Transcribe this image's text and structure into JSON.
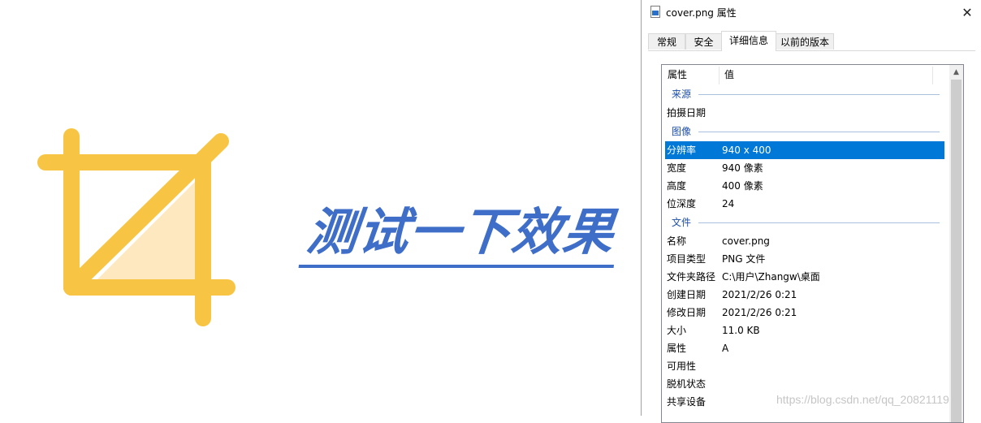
{
  "headline": "测试一下效果",
  "colors": {
    "icon_yellow": "#f7c543",
    "icon_fill": "#fde8bf",
    "headline_blue": "#3e6ec8",
    "selection": "#0078d7"
  },
  "window": {
    "title": "cover.png 属性",
    "close_icon": "✕",
    "tabs": [
      "常规",
      "安全",
      "详细信息",
      "以前的版本"
    ],
    "active_tab": "详细信息",
    "columns": {
      "property": "属性",
      "value": "值"
    },
    "groups": {
      "source": "来源",
      "image": "图像",
      "file": "文件"
    },
    "source_rows": [
      {
        "k": "拍摄日期",
        "v": ""
      }
    ],
    "image_rows": [
      {
        "k": "分辨率",
        "v": "940 x 400"
      },
      {
        "k": "宽度",
        "v": "940 像素"
      },
      {
        "k": "高度",
        "v": "400 像素"
      },
      {
        "k": "位深度",
        "v": "24"
      }
    ],
    "file_rows": [
      {
        "k": "名称",
        "v": "cover.png"
      },
      {
        "k": "项目类型",
        "v": "PNG 文件"
      },
      {
        "k": "文件夹路径",
        "v": "C:\\用户\\Zhangw\\桌面"
      },
      {
        "k": "创建日期",
        "v": "2021/2/26 0:21"
      },
      {
        "k": "修改日期",
        "v": "2021/2/26 0:21"
      },
      {
        "k": "大小",
        "v": "11.0 KB"
      },
      {
        "k": "属性",
        "v": "A"
      },
      {
        "k": "可用性",
        "v": ""
      },
      {
        "k": "脱机状态",
        "v": ""
      },
      {
        "k": "共享设备",
        "v": ""
      }
    ]
  },
  "watermark": "https://blog.csdn.net/qq_20821119"
}
